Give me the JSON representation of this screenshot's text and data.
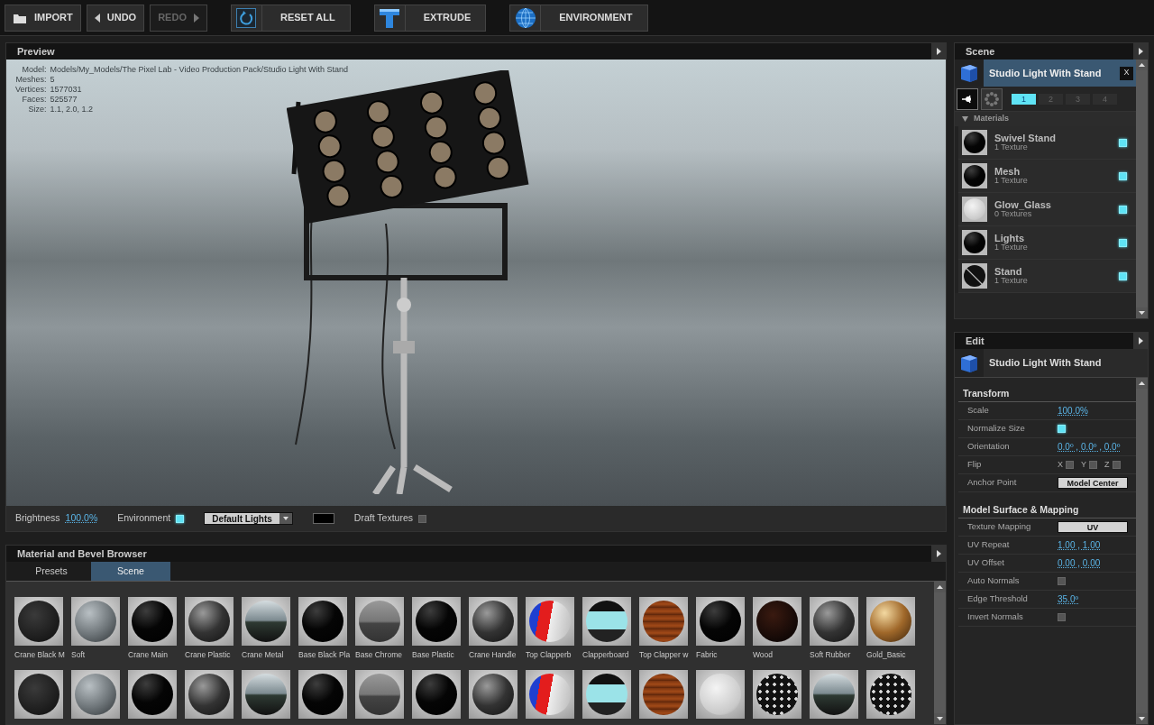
{
  "toolbar": [
    {
      "label": "IMPORT",
      "kind": "folder",
      "disabled": false
    },
    {
      "label": "UNDO",
      "kind": "left",
      "disabled": false
    },
    {
      "label": "REDO",
      "kind": "right",
      "disabled": true
    },
    {
      "label": "RESET ALL",
      "kind": "reset",
      "disabled": false
    },
    {
      "label": "EXTRUDE",
      "kind": "extrude",
      "disabled": false
    },
    {
      "label": "ENVIRONMENT",
      "kind": "globe",
      "disabled": false
    }
  ],
  "preview": {
    "title": "Preview",
    "info": [
      {
        "label": "Model:",
        "value": "Models/My_Models/The Pixel Lab - Video Production Pack/Studio Light With Stand"
      },
      {
        "label": "Meshes:",
        "value": "5"
      },
      {
        "label": "Vertices:",
        "value": "1577031"
      },
      {
        "label": "Faces:",
        "value": "525577"
      },
      {
        "label": "Size:",
        "value": "1.1, 2.0, 1.2"
      }
    ],
    "brightness_label": "Brightness",
    "brightness_value": "100.0%",
    "environment": {
      "label": "Environment",
      "checked": true
    },
    "lights": "Default Lights",
    "draft_textures": {
      "label": "Draft Textures",
      "checked": false
    }
  },
  "browser": {
    "title": "Material and Bevel Browser",
    "tabs": [
      {
        "label": "Presets",
        "selected": false
      },
      {
        "label": "Scene",
        "selected": true
      }
    ],
    "rows": [
      [
        {
          "name": "Crane Black M",
          "kind": "dark"
        },
        {
          "name": "Soft",
          "kind": "grey"
        },
        {
          "name": "Crane Main",
          "kind": "black"
        },
        {
          "name": "Crane Plastic",
          "kind": "glossy"
        },
        {
          "name": "Crane Metal",
          "kind": "chrome"
        },
        {
          "name": "Base Black Pla",
          "kind": "black"
        },
        {
          "name": "Base Chrome",
          "kind": "mist"
        },
        {
          "name": "Base Plastic",
          "kind": "black"
        },
        {
          "name": "Crane Handle",
          "kind": "glossy"
        },
        {
          "name": "Top Clapperb",
          "kind": "flag"
        },
        {
          "name": "Clapperboard",
          "kind": "clapper"
        },
        {
          "name": "Top Clapper w",
          "kind": "wood"
        },
        {
          "name": "Fabric",
          "kind": "black"
        },
        {
          "name": "Wood",
          "kind": "darkwood"
        },
        {
          "name": "Soft Rubber",
          "kind": "glossy"
        },
        {
          "name": "Gold_Basic",
          "kind": "gold"
        }
      ],
      [
        {
          "kind": "dark"
        },
        {
          "kind": "grey"
        },
        {
          "kind": "black"
        },
        {
          "kind": "glossy"
        },
        {
          "kind": "chrome"
        },
        {
          "kind": "black"
        },
        {
          "kind": "mist"
        },
        {
          "kind": "black"
        },
        {
          "kind": "glossy"
        },
        {
          "kind": "flag"
        },
        {
          "kind": "clapper"
        },
        {
          "kind": "wood"
        },
        {
          "kind": "white"
        },
        {
          "kind": "pattern"
        },
        {
          "kind": "chrome"
        },
        {
          "kind": "pattern"
        }
      ]
    ]
  },
  "scene": {
    "title": "Scene",
    "object": "Studio Light With Stand",
    "close": "X",
    "modes": [
      {
        "kind": "nodes",
        "selected": true
      },
      {
        "kind": "dots",
        "selected": false
      }
    ],
    "pages": [
      {
        "label": "1",
        "selected": true
      },
      {
        "label": "2",
        "selected": false
      },
      {
        "label": "3",
        "selected": false
      },
      {
        "label": "4",
        "selected": false
      }
    ],
    "materials_label": "Materials",
    "materials_expanded": true,
    "materials": [
      {
        "name": "Swivel Stand",
        "textures": "1 Texture",
        "checked": true,
        "kind": "black"
      },
      {
        "name": "Mesh",
        "textures": "1 Texture",
        "checked": true,
        "kind": "black"
      },
      {
        "name": "Glow_Glass",
        "textures": "0 Textures",
        "checked": true,
        "kind": "white"
      },
      {
        "name": "Lights",
        "textures": "1 Texture",
        "checked": true,
        "kind": "black"
      },
      {
        "name": "Stand",
        "textures": "1 Texture",
        "checked": true,
        "kind": "cross"
      }
    ]
  },
  "edit": {
    "title": "Edit",
    "object": "Studio Light With Stand",
    "sections": [
      {
        "title": "Transform",
        "rows": [
          {
            "label": "Scale",
            "kind": "link",
            "value": "100.0%"
          },
          {
            "label": "Normalize Size",
            "kind": "check",
            "checked": true
          },
          {
            "label": "Orientation",
            "kind": "link",
            "value": "0.0º , 0.0º , 0.0º"
          },
          {
            "label": "Flip",
            "kind": "axes",
            "axes": [
              {
                "label": "X",
                "checked": false
              },
              {
                "label": "Y",
                "checked": false
              },
              {
                "label": "Z",
                "checked": false
              }
            ]
          },
          {
            "label": "Anchor Point",
            "kind": "button",
            "value": "Model Center"
          }
        ]
      },
      {
        "title": "Model Surface & Mapping",
        "rows": [
          {
            "label": "Texture Mapping",
            "kind": "button",
            "value": "UV"
          },
          {
            "label": "UV Repeat",
            "kind": "link",
            "value": "1.00 , 1.00"
          },
          {
            "label": "UV Offset",
            "kind": "link",
            "value": "0.00 , 0.00"
          },
          {
            "label": "Auto Normals",
            "kind": "check",
            "checked": false
          },
          {
            "label": "Edge Threshold",
            "kind": "link",
            "value": "35.0º"
          },
          {
            "label": "Invert Normals",
            "kind": "check",
            "checked": false
          }
        ]
      }
    ]
  }
}
